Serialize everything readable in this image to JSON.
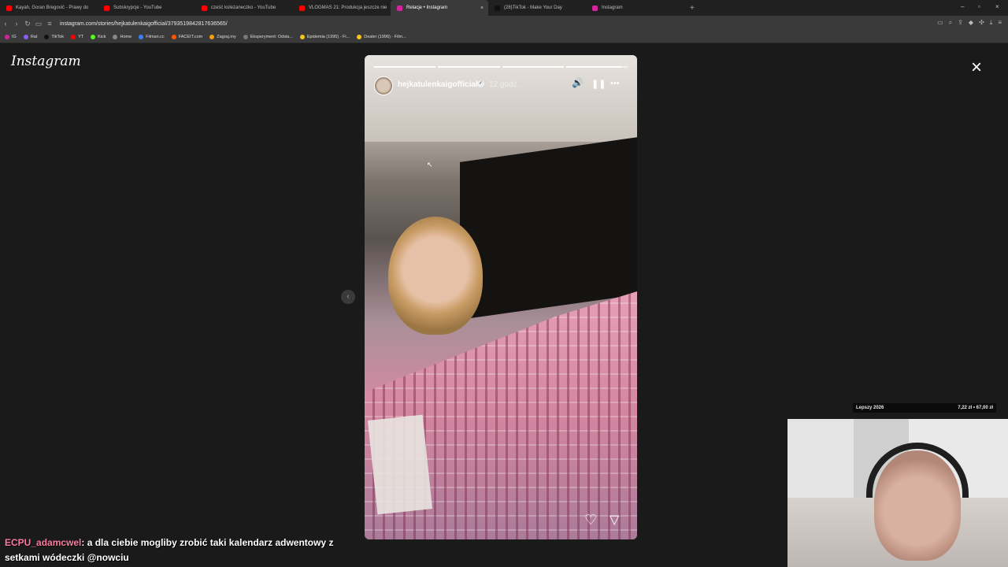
{
  "tabs": [
    {
      "title": "Kayah, Goran Bregović - Prawy do",
      "color": "#ff0000",
      "active": false
    },
    {
      "title": "Subskrypcje - YouTube",
      "color": "#ff0000",
      "active": false
    },
    {
      "title": "cześć koleżaneczko - YouTube",
      "color": "#ff0000",
      "active": false
    },
    {
      "title": "VLOGMAS 21: Produkcja jeszcze nie",
      "color": "#ff0000",
      "active": false
    },
    {
      "title": "Relacje • Instagram",
      "color": "#d6249f",
      "active": true
    },
    {
      "title": "(28)TikTok - Make Your Day",
      "color": "#111111",
      "active": false
    },
    {
      "title": "Instagram",
      "color": "#d6249f",
      "active": false
    }
  ],
  "new_tab": "+",
  "url": "instagram.com/stories/hejkatulenkaigofficial/3793519842817636565/",
  "bookmarks": [
    {
      "label": "IG",
      "color": "#d6249f"
    },
    {
      "label": "Rat",
      "color": "#8b5cf6"
    },
    {
      "label": "TikTok",
      "color": "#111111"
    },
    {
      "label": "YT",
      "color": "#ff0000"
    },
    {
      "label": "Kick",
      "color": "#53fc18"
    },
    {
      "label": "Home",
      "color": "#888888"
    },
    {
      "label": "Filman.cc",
      "color": "#3b82f6"
    },
    {
      "label": "FACEIT.com",
      "color": "#ff5500"
    },
    {
      "label": "Zagraj.my",
      "color": "#f59e0b"
    },
    {
      "label": "Eksperyment: Odsia...",
      "color": "#777777"
    },
    {
      "label": "Epidemia (1995) - Fi...",
      "color": "#f5c518"
    },
    {
      "label": "Dealer (1996) - Film...",
      "color": "#f5c518"
    }
  ],
  "instagram": {
    "logo": "Instagram",
    "close_icon": "×",
    "prev_icon": "‹",
    "story": {
      "username": "hejkatulenkaigofficial",
      "verified_icon": "✓",
      "time": "12 godz.",
      "progress_segments": 4,
      "current_segment": 4,
      "current_progress": 0.9,
      "mute_icon": "🔊",
      "pause_icon": "❚❚",
      "more_icon": "•••",
      "heart_icon": "♡",
      "share_icon": "▽"
    }
  },
  "stream_overlay": {
    "label": "Lepszy 2026",
    "amount": "7,22 zł • 67,00 zł"
  },
  "chat": {
    "user": "ECPU_adamcwel",
    "message": ": a dla ciebie mogliby zrobić taki kalendarz adwentowy z setkami wódeczki @nowciu"
  }
}
